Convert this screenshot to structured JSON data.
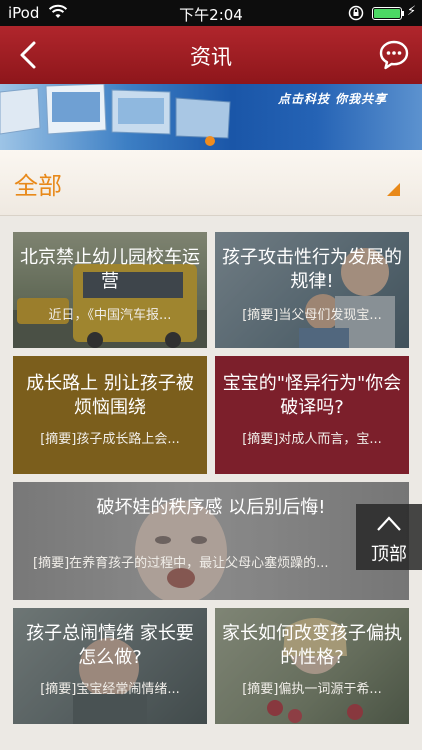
{
  "status_bar": {
    "carrier": "iPod",
    "time": "下午2:04",
    "battery_level": 1.0,
    "icons": [
      "wifi-icon",
      "rotation-lock-icon",
      "battery-icon",
      "charging-bolt-icon"
    ]
  },
  "nav": {
    "title": "资讯",
    "left_icon": "back-chevron-icon",
    "right_icon": "message-bubble-icon",
    "bar_color": "#9e1d22"
  },
  "banner": {
    "slogan": "点击科技 你我共享"
  },
  "category": {
    "label": "全部",
    "accent_color": "#e8891a"
  },
  "articles": [
    {
      "title": "北京禁止幼儿园校车运营",
      "summary": "近日，《中国汽车报..."
    },
    {
      "title": "孩子攻击性行为发展的规律!",
      "summary": "[摘要]当父母们发现宝..."
    },
    {
      "title": "成长路上 别让孩子被烦恼围绕",
      "summary": "[摘要]孩子成长路上会..."
    },
    {
      "title": "宝宝的\"怪异行为\"你会破译吗?",
      "summary": "[摘要]对成人而言，宝..."
    },
    {
      "title": "破坏娃的秩序感 以后别后悔!",
      "summary": "[摘要]在养育孩子的过程中，最让父母心塞烦躁的..."
    },
    {
      "title": "孩子总闹情绪 家长要怎么做?",
      "summary": "[摘要]宝宝经常闹情绪..."
    },
    {
      "title": "家长如何改变孩子偏执的性格?",
      "summary": "[摘要]偏执一词源于希..."
    }
  ],
  "tile_colors": {
    "gold": "#7b5e1c",
    "maroon": "#7c1f2b"
  },
  "top_button": {
    "label": "顶部"
  }
}
